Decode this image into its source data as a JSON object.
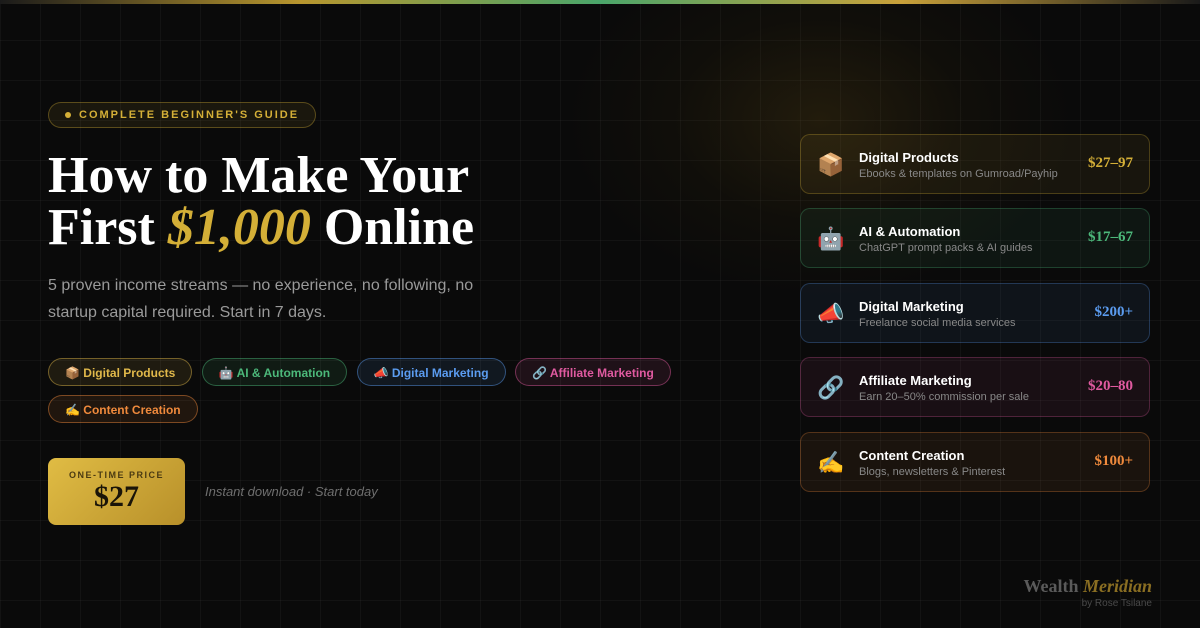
{
  "eyebrow": "COMPLETE BEGINNER'S GUIDE",
  "headline": {
    "line1": "How to Make Your",
    "line2_prefix": "First ",
    "line2_highlight": "$1,000",
    "line2_suffix": " Online"
  },
  "subtitle": "5 proven income streams — no experience, no following, no startup capital required. Start in 7 days.",
  "chips": [
    {
      "label": "📦 Digital Products",
      "color": "#e0b84a"
    },
    {
      "label": "🤖 AI & Automation",
      "color": "#4cb87a"
    },
    {
      "label": "📣 Digital Marketing",
      "color": "#5b9cf0"
    },
    {
      "label": "🔗 Affiliate Marketing",
      "color": "#e05aa0"
    },
    {
      "label": "✍️ Content Creation",
      "color": "#f08a3c"
    }
  ],
  "price": {
    "label": "ONE-TIME PRICE",
    "value": "$27",
    "note": "Instant download · Start today"
  },
  "streams": [
    {
      "icon": "📦",
      "icon_name": "package-icon",
      "title": "Digital Products",
      "desc": "Ebooks & templates on Gumroad/Payhip",
      "price": "$27–97",
      "color": "#d4af37"
    },
    {
      "icon": "🤖",
      "icon_name": "robot-icon",
      "title": "AI & Automation",
      "desc": "ChatGPT prompt packs & AI guides",
      "price": "$17–67",
      "color": "#4cb87a"
    },
    {
      "icon": "📣",
      "icon_name": "megaphone-icon",
      "title": "Digital Marketing",
      "desc": "Freelance social media services",
      "price": "$200+",
      "color": "#5b9cf0"
    },
    {
      "icon": "🔗",
      "icon_name": "link-icon",
      "title": "Affiliate Marketing",
      "desc": "Earn 20–50% commission per sale",
      "price": "$20–80",
      "color": "#e05aa0"
    },
    {
      "icon": "✍️",
      "icon_name": "writing-hand-icon",
      "title": "Content Creation",
      "desc": "Blogs, newsletters & Pinterest",
      "price": "$100+",
      "color": "#f08a3c"
    }
  ],
  "brand": {
    "name_prefix": "Wealth ",
    "name_highlight": "Meridian",
    "byline": "by Rose Tsilane"
  }
}
